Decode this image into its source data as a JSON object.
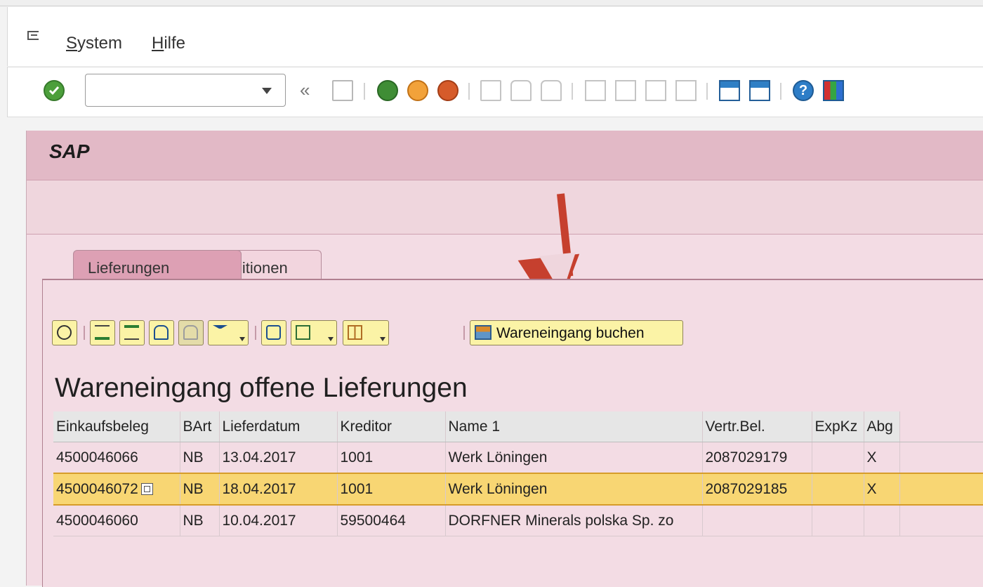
{
  "menu": {
    "items": [
      {
        "first": "S",
        "rest": "ystem"
      },
      {
        "first": "H",
        "rest": "ilfe"
      }
    ]
  },
  "toolbar": {
    "command_field_value": "",
    "icons": [
      "check-icon",
      "dropdown-icon",
      "double-left-icon",
      "save-icon",
      "back-icon",
      "exit-icon",
      "cancel-icon",
      "print-icon",
      "find-icon",
      "find-next-icon",
      "first-page-icon",
      "previous-page-icon",
      "next-page-icon",
      "last-page-icon",
      "create-session-icon",
      "shortcut-icon",
      "help-icon",
      "customize-layout-icon"
    ]
  },
  "app": {
    "title": "SAP"
  },
  "tabs": [
    {
      "label": "Lieferungen",
      "active": true
    },
    {
      "label": "Positionen",
      "active": false
    }
  ],
  "grid_toolbar": {
    "post_button_label": "Wareneingang buchen"
  },
  "grid": {
    "title": "Wareneingang offene Lieferungen",
    "columns": [
      "Einkaufsbeleg",
      "BArt",
      "Lieferdatum",
      "Kreditor",
      "Name 1",
      "Vertr.Bel.",
      "ExpKz",
      "Abg"
    ],
    "rows": [
      {
        "einkaufsbeleg": "4500046066",
        "bart": "NB",
        "lieferdatum": "13.04.2017",
        "kreditor": "1001",
        "name1": "Werk Löningen",
        "vertr_bel": "2087029179",
        "expkz": "",
        "abg": "X",
        "selected": false
      },
      {
        "einkaufsbeleg": "4500046072",
        "bart": "NB",
        "lieferdatum": "18.04.2017",
        "kreditor": "1001",
        "name1": "Werk Löningen",
        "vertr_bel": "2087029185",
        "expkz": "",
        "abg": "X",
        "selected": true
      },
      {
        "einkaufsbeleg": "4500046060",
        "bart": "NB",
        "lieferdatum": "10.04.2017",
        "kreditor": "59500464",
        "name1": "DORFNER Minerals polska Sp. zo",
        "vertr_bel": "",
        "expkz": "",
        "abg": "",
        "selected": false
      }
    ]
  },
  "colors": {
    "background": "#f3f3f3",
    "title_bar": "#e2b9c6",
    "active_tab": "#dda0b4",
    "selected_row": "#f8d673",
    "grid_button": "#fbf3a6",
    "annotation_arrow": "#c6402e"
  }
}
